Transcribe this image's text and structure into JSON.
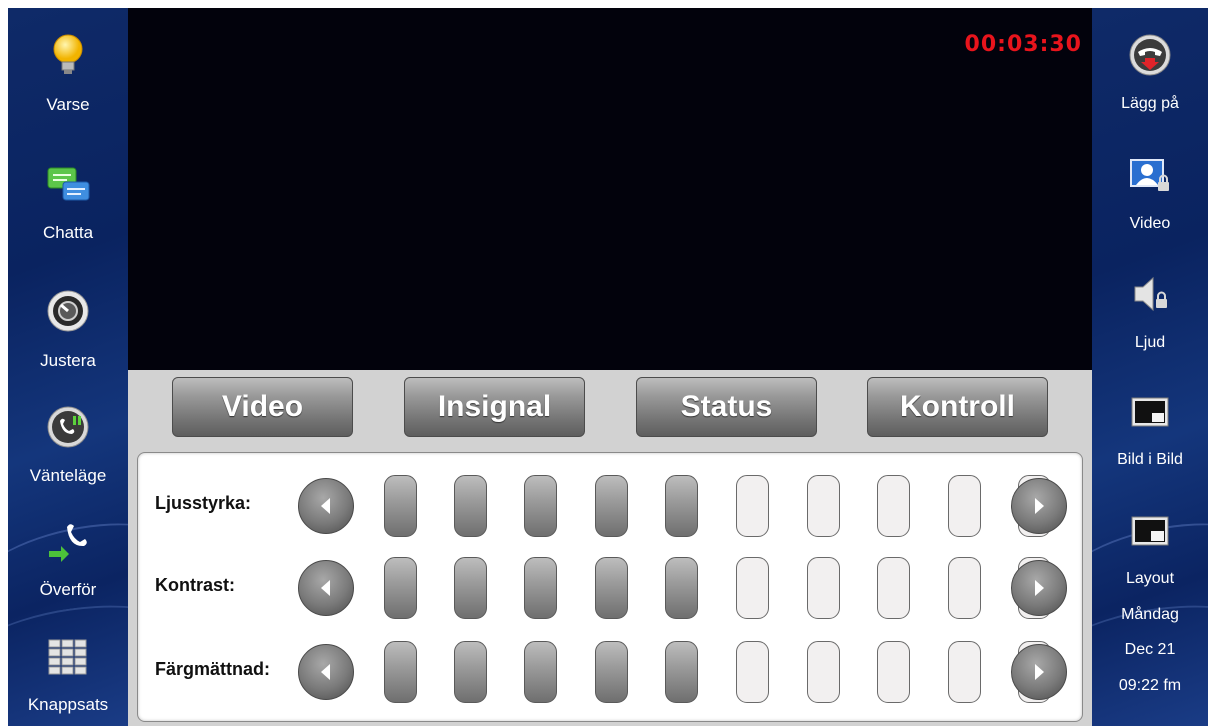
{
  "left_sidebar": [
    {
      "label": "Varse",
      "icon": "lightbulb-icon"
    },
    {
      "label": "Chatta",
      "icon": "chat-icon"
    },
    {
      "label": "Justera",
      "icon": "adjust-icon"
    },
    {
      "label": "Vänteläge",
      "icon": "hold-icon"
    },
    {
      "label": "Överför",
      "icon": "transfer-icon"
    },
    {
      "label": "Knappsats",
      "icon": "keypad-icon"
    }
  ],
  "right_sidebar": [
    {
      "label": "Lägg på",
      "icon": "hang-up-icon"
    },
    {
      "label": "Video",
      "icon": "video-lock-icon"
    },
    {
      "label": "Ljud",
      "icon": "audio-lock-icon"
    },
    {
      "label": "Bild i Bild",
      "icon": "picture-in-picture-icon"
    },
    {
      "label": "Layout",
      "icon": "layout-icon"
    }
  ],
  "datetime": {
    "day": "Måndag",
    "date": "Dec 21",
    "time": "09:22 fm"
  },
  "call_timer": "00:03:30",
  "tabs": [
    "Video",
    "Insignal",
    "Status",
    "Kontroll"
  ],
  "settings": [
    {
      "label": "Ljusstyrka:",
      "level": 5,
      "max": 10
    },
    {
      "label": "Kontrast:",
      "level": 5,
      "max": 10
    },
    {
      "label": "Färgmättnad:",
      "level": 5,
      "max": 10
    }
  ],
  "colors": {
    "sidebar": "#0f2a68",
    "timer": "#e8141c",
    "video_bg": "#02020c"
  }
}
